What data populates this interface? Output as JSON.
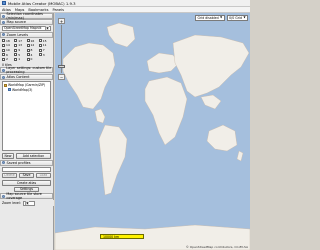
{
  "window": {
    "title": "Mobile Atlas Creator (MOBAC) 1.9.3"
  },
  "menu": [
    "Atlas",
    "Maps",
    "Bookmarks",
    "Panels"
  ],
  "left": {
    "selection_header": "Selection coordinates (min/max)",
    "map_source_header": "Map source",
    "map_source_value": "OpenStreetMap Mapnik",
    "zoom_header": "Zoom Levels",
    "zoom_levels": [
      "18",
      "17",
      "16",
      "15",
      "14",
      "13",
      "12",
      "11",
      "10",
      "9",
      "8",
      "7",
      "6",
      "5",
      "4",
      "3",
      "2",
      "1",
      "0"
    ],
    "zoom_tiles": "0 tiles",
    "layer_settings_header": "Layer settings: custom tile processing",
    "atlas_header": "Atlas Content",
    "atlas_root": "WorldMap (Garmin/ZIP)",
    "atlas_layer": "WorldMap(3)",
    "btn_new": "New",
    "btn_add_selection": "Add selection",
    "profiles_header": "Saved profiles",
    "btn_delete": "Delete",
    "btn_save": "Save",
    "btn_load": "Load",
    "btn_create_atlas": "Create atlas",
    "btn_settings": "Settings",
    "coverage_header": "Map source tile store coverage",
    "zoom_level_label": "Zoom level:"
  },
  "map": {
    "grid_select": "Grid disabled",
    "map_source_select": "0/0 Grid",
    "scale_text": "10000 km",
    "attribution": "© OpenStreetMap contributors, CC-BY-SA"
  },
  "colors": {
    "water": "#a5bfdd",
    "land": "#f1eee8",
    "scalebar": "#fff200"
  }
}
